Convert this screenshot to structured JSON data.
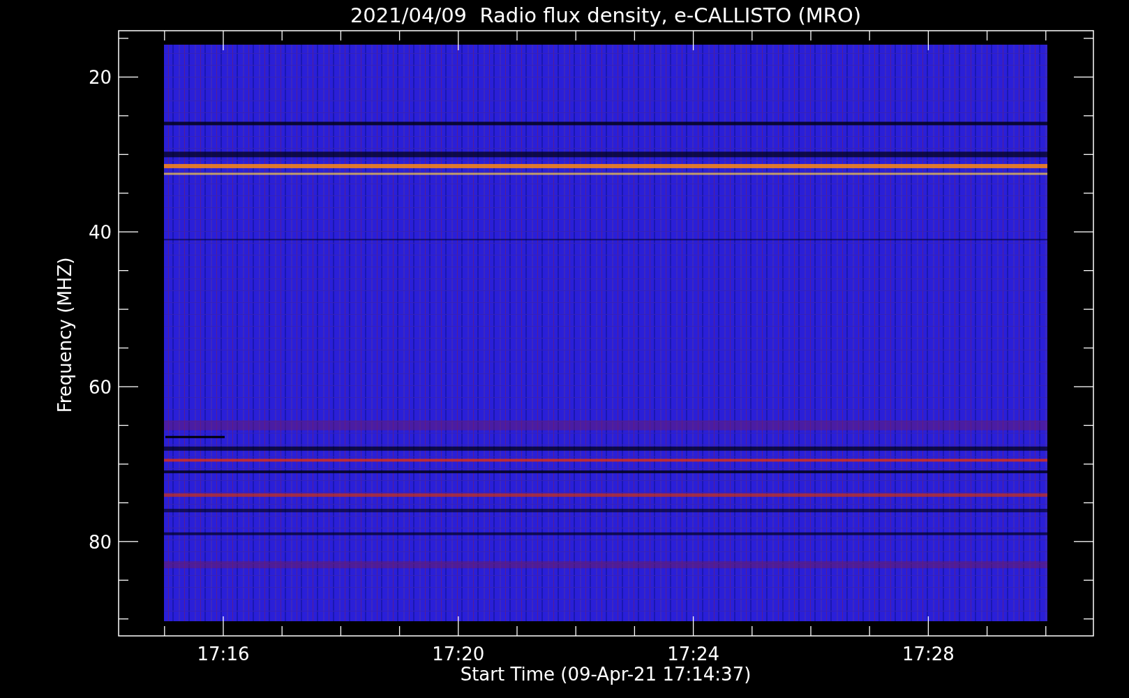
{
  "plot": {
    "title": "2021/04/09  Radio flux density, e-CALLISTO (MRO)",
    "ylabel": "Frequency (MHZ)",
    "xlabel": "Start Time (09-Apr-21 17:14:37)",
    "ytick_labels": [
      "20",
      "40",
      "60",
      "80"
    ],
    "xtick_labels": [
      "17:16",
      "17:20",
      "17:24",
      "17:28"
    ]
  }
}
